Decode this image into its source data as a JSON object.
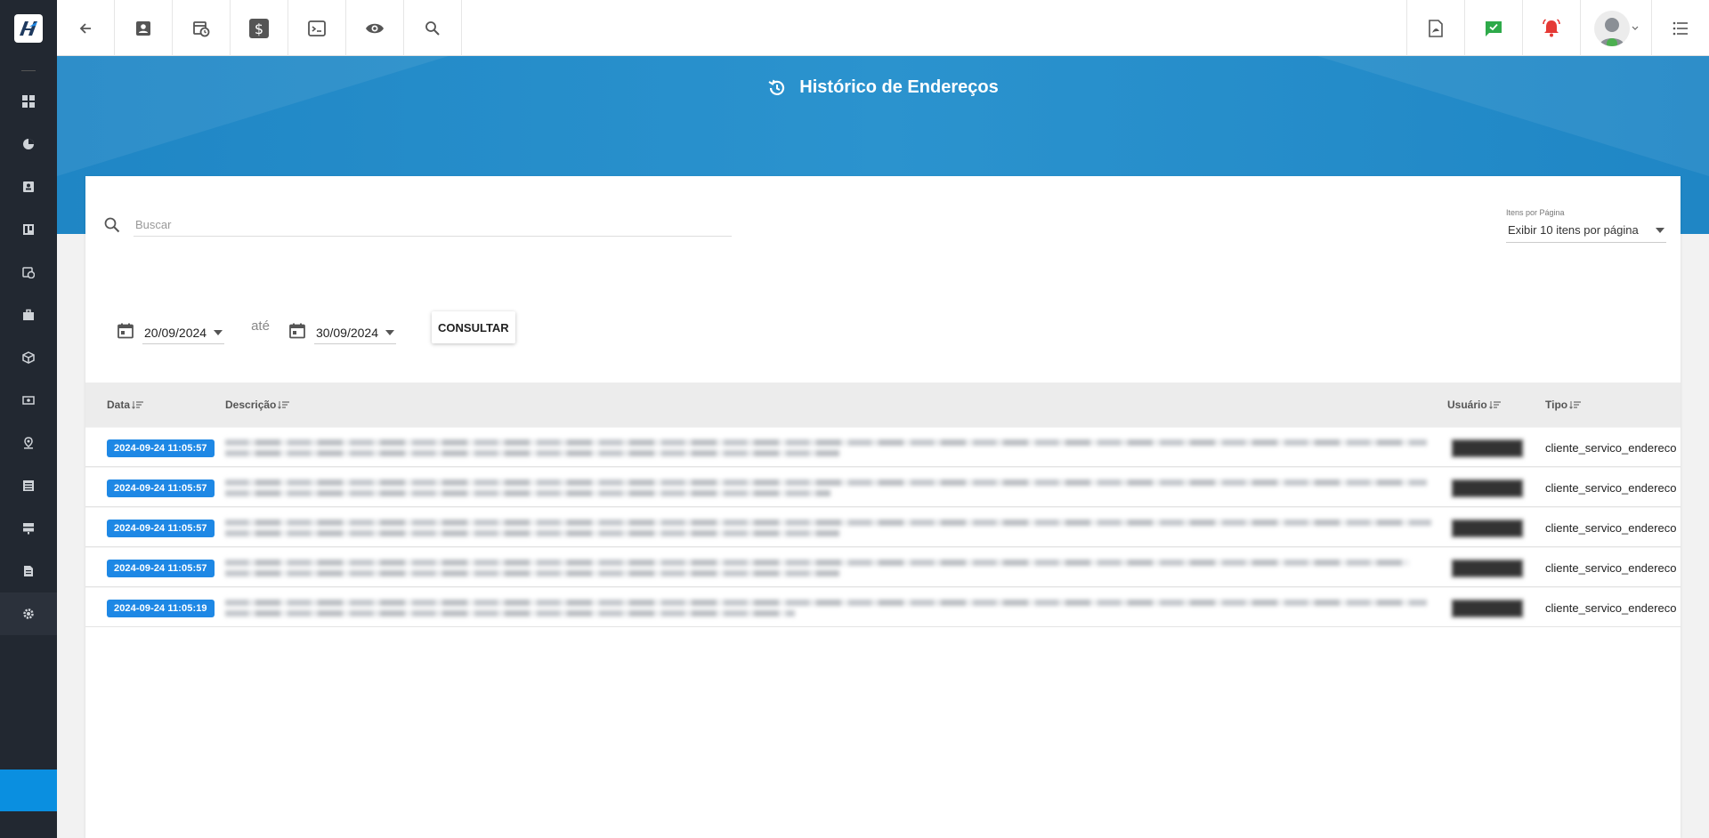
{
  "sidebar": {
    "logo_icon": "app-logo",
    "items": [
      {
        "icon": "dashboard-icon"
      },
      {
        "icon": "pie-chart-icon"
      },
      {
        "icon": "contact-card-icon"
      },
      {
        "icon": "kanban-icon"
      },
      {
        "icon": "calendar-clock-icon"
      },
      {
        "icon": "briefcase-icon"
      },
      {
        "icon": "cube-icon"
      },
      {
        "icon": "money-icon"
      },
      {
        "icon": "location-icon"
      },
      {
        "icon": "list-icon"
      },
      {
        "icon": "server-icon"
      },
      {
        "icon": "document-icon"
      },
      {
        "icon": "gear-icon"
      }
    ],
    "active_color": "#0a8fe0"
  },
  "topbar": {
    "left_icons": [
      "back-arrow-icon",
      "contact-icon",
      "calendar-clock-icon",
      "dollar-icon",
      "terminal-icon",
      "eye-icon",
      "search-icon"
    ],
    "right_icons": [
      "pdf-icon",
      "chat-check-icon",
      "bell-icon"
    ],
    "colors": {
      "chat": "#2eaa4a",
      "bell": "#e53935"
    }
  },
  "header": {
    "title": "Histórico de Endereços",
    "banner_color": "#228bc9"
  },
  "search": {
    "placeholder": "Buscar",
    "value": ""
  },
  "per_page": {
    "label": "Itens por Página",
    "value": "Exibir 10 itens por página"
  },
  "filters": {
    "start_date": "20/09/2024",
    "separator": "até",
    "end_date": "30/09/2024",
    "submit_label": "CONSULTAR"
  },
  "table": {
    "columns": [
      "Data",
      "Descrição",
      "Usuário",
      "Tipo"
    ],
    "rows": [
      {
        "date": "2024-09-24 11:05:57",
        "tipo": "cliente_servico_endereco"
      },
      {
        "date": "2024-09-24 11:05:57",
        "tipo": "cliente_servico_endereco"
      },
      {
        "date": "2024-09-24 11:05:57",
        "tipo": "cliente_servico_endereco"
      },
      {
        "date": "2024-09-24 11:05:57",
        "tipo": "cliente_servico_endereco"
      },
      {
        "date": "2024-09-24 11:05:19",
        "tipo": "cliente_servico_endereco"
      }
    ]
  }
}
